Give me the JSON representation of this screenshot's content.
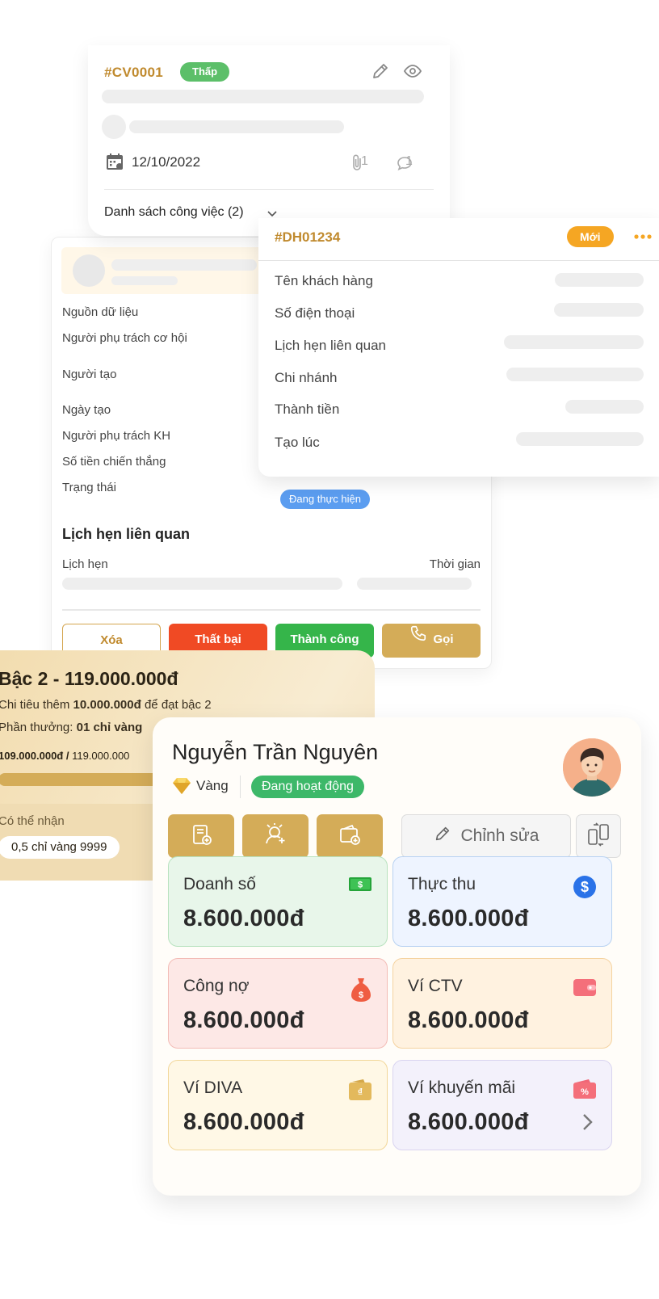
{
  "task_card": {
    "code": "#CV0001",
    "priority": "Thấp",
    "date": "12/10/2022",
    "attachments": "1",
    "comments": "1",
    "task_list_label": "Danh sách công việc (2)"
  },
  "opportunity_card": {
    "fields": [
      "Nguồn dữ liệu",
      "Người phụ trách cơ hội",
      "Người tạo",
      "Ngày tạo",
      "Người phụ trách KH",
      "Số tiền chiến thắng",
      "Trạng thái"
    ],
    "status": "Đang thực hiện",
    "section_title": "Lịch hẹn liên quan",
    "col_left": "Lịch hẹn",
    "col_right": "Thời gian",
    "buttons": {
      "delete": "Xóa",
      "fail": "Thất bại",
      "success": "Thành công",
      "call": "Gọi"
    }
  },
  "order_card": {
    "code": "#DH01234",
    "badge": "Mới",
    "fields": [
      "Tên khách hàng",
      "Số điện thoại",
      "Lịch hẹn liên quan",
      "Chi nhánh",
      "Thành tiền",
      "Tạo lúc"
    ]
  },
  "tier_card": {
    "title": "Bậc 2 - 119.000.000đ",
    "line1_prefix": "Chi tiêu thêm ",
    "line1_amount": "10.000.000đ",
    "line1_suffix": " để đạt bậc 2",
    "line2_prefix": "Phần thưởng: ",
    "line2_value": "01 chỉ vàng",
    "progress_current": "109.000.000đ",
    "progress_sep": " / ",
    "progress_target": "119.000.000",
    "progress_ratio": 0.916,
    "reward_label": "Có thể nhận",
    "reward_value": "0,5 chỉ vàng 9999"
  },
  "customer_card": {
    "name": "Nguyễn Trần Nguyên",
    "tier": "Vàng",
    "status": "Đang hoạt động",
    "edit_label": "Chỉnh sửa",
    "stats": [
      {
        "label": "Doanh số",
        "value": "8.600.000đ"
      },
      {
        "label": "Thực thu",
        "value": "8.600.000đ"
      },
      {
        "label": "Công nợ",
        "value": "8.600.000đ"
      },
      {
        "label": "Ví CTV",
        "value": "8.600.000đ"
      },
      {
        "label": "Ví DIVA",
        "value": "8.600.000đ"
      },
      {
        "label": "Ví khuyến mãi",
        "value": "8.600.000đ"
      }
    ]
  },
  "colors": {
    "gold": "#d4ac58",
    "gold_text": "#c08a2e",
    "green": "#35b54a",
    "red": "#f04a24",
    "blue": "#5b9df0",
    "orange": "#f5a623"
  }
}
